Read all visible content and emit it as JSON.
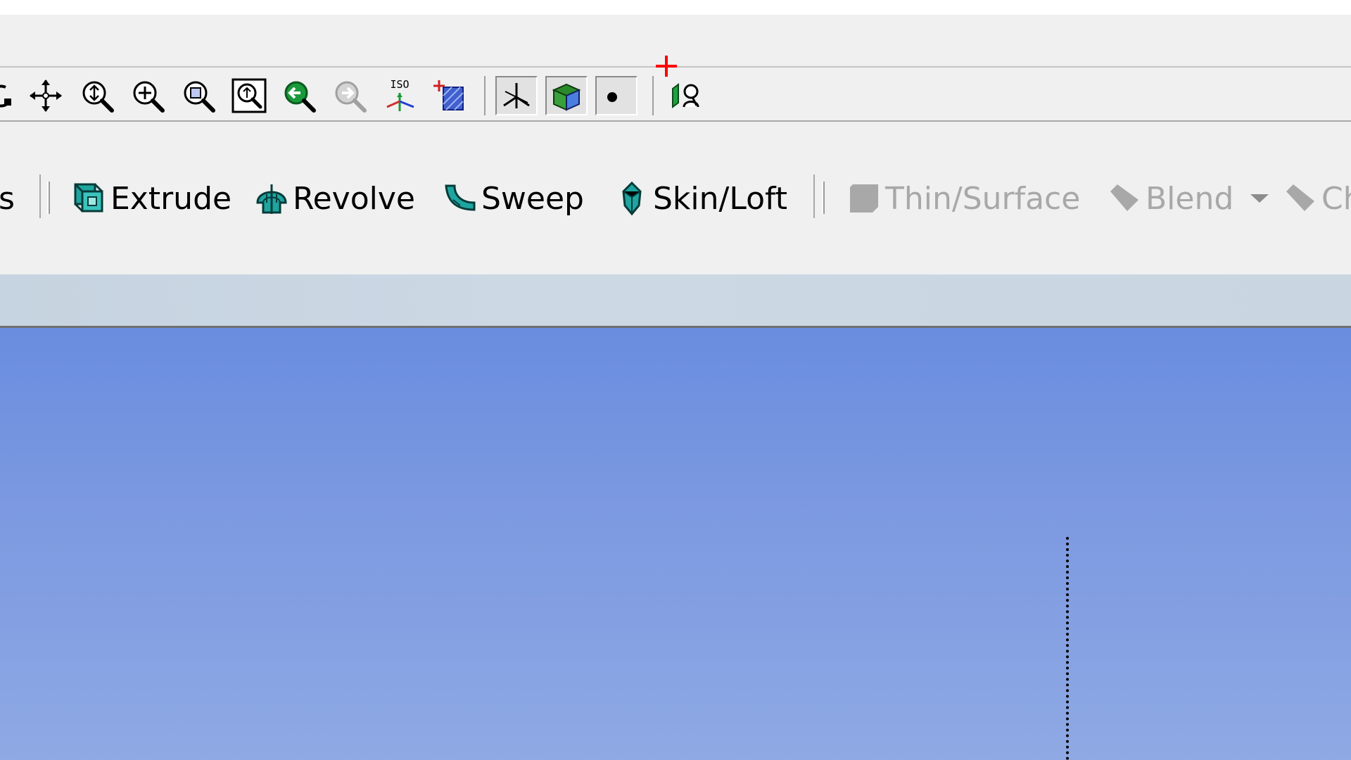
{
  "features_toolbar": {
    "partial_left_label": "s",
    "extrude_label": "Extrude",
    "revolve_label": "Revolve",
    "sweep_label": "Sweep",
    "skin_loft_label": "Skin/Loft",
    "thin_surface_label": "Thin/Surface",
    "blend_label": "Blend",
    "partial_right_label": "Ch"
  },
  "view_toolbar": {
    "iso_label": "ISO",
    "pressed_buttons": [
      "display-edges-button",
      "shaded-mode-button",
      "display-points-button"
    ]
  },
  "colors": {
    "viewport_top": "#6a8ddf",
    "viewport_bottom": "#8fa9e4",
    "feature_icon_teal": "#1fa5a0",
    "cursor_red": "#ff0000",
    "zoom_green": "#1a9a3a"
  }
}
